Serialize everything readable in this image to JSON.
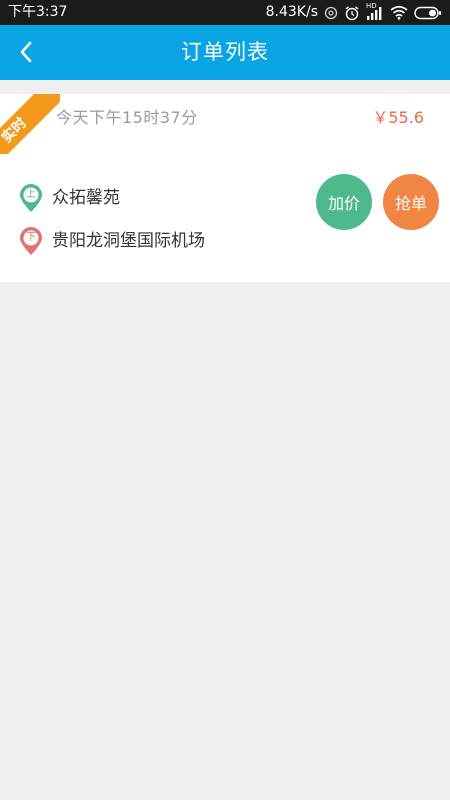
{
  "status_bar": {
    "time": "下午3:37",
    "net_speed": "8.43K/s",
    "signal_badge": "HD"
  },
  "header": {
    "title": "订单列表"
  },
  "order": {
    "tag": "实时",
    "time": "今天下午15时37分",
    "price": "￥55.6",
    "pickup": {
      "marker": "上",
      "address": "众拓馨苑"
    },
    "dropoff": {
      "marker": "下",
      "address": "贵阳龙洞堡国际机场"
    },
    "add_price_label": "加价",
    "grab_label": "抢单"
  },
  "colors": {
    "status_bar": "#1b1b1b",
    "nav_bar": "#08a4e4",
    "background": "#efefef",
    "ribbon": "#f39a1d",
    "price": "#e86a4a",
    "pickup_pin": "#4eb98a",
    "dropoff_pin": "#e07373",
    "add_price_button": "#4eb98a",
    "grab_button": "#f08544"
  },
  "icons": {
    "back": "chevron-left-icon",
    "alarm": "alarm-icon",
    "signal": "signal-icon",
    "wifi": "wifi-icon",
    "battery": "battery-icon",
    "pickup": "pickup-pin-icon",
    "dropoff": "dropoff-pin-icon"
  }
}
